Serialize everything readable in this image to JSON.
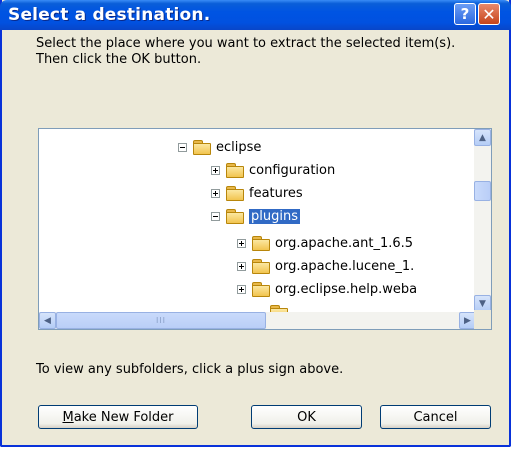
{
  "window": {
    "title": "Select a destination.",
    "help_glyph": "?",
    "close_glyph": "✕"
  },
  "instructions": "Select the place where you want to extract the selected item(s).  Then click the OK button.",
  "tree": {
    "nodes": [
      {
        "label": "eclipse",
        "expander": "minus",
        "icon": "folder-icon"
      },
      {
        "label": "configuration",
        "expander": "plus",
        "icon": "folder-icon"
      },
      {
        "label": "features",
        "expander": "plus",
        "icon": "folder-icon"
      },
      {
        "label": "plugins",
        "expander": "minus",
        "icon": "folder-icon",
        "selected": true
      },
      {
        "label": "org.apache.ant_1.6.5",
        "expander": "plus",
        "icon": "folder-icon"
      },
      {
        "label": "org.apache.lucene_1.",
        "expander": "plus",
        "icon": "folder-icon"
      },
      {
        "label": "org.eclipse.help.weba",
        "expander": "plus",
        "icon": "folder-icon"
      }
    ],
    "hscroll_grip": "III",
    "vscroll_position": 0.3,
    "hscroll_position": 0.0
  },
  "hint": "To view any subfolders, click a plus sign above.",
  "buttons": {
    "make_new_folder_prefix": "M",
    "make_new_folder_rest": "ake New Folder",
    "ok": "OK",
    "cancel": "Cancel"
  },
  "colors": {
    "titlebar": "#0054e3",
    "dialog_bg": "#ece9d8",
    "selection": "#316ac5",
    "close_button": "#c6441b"
  }
}
